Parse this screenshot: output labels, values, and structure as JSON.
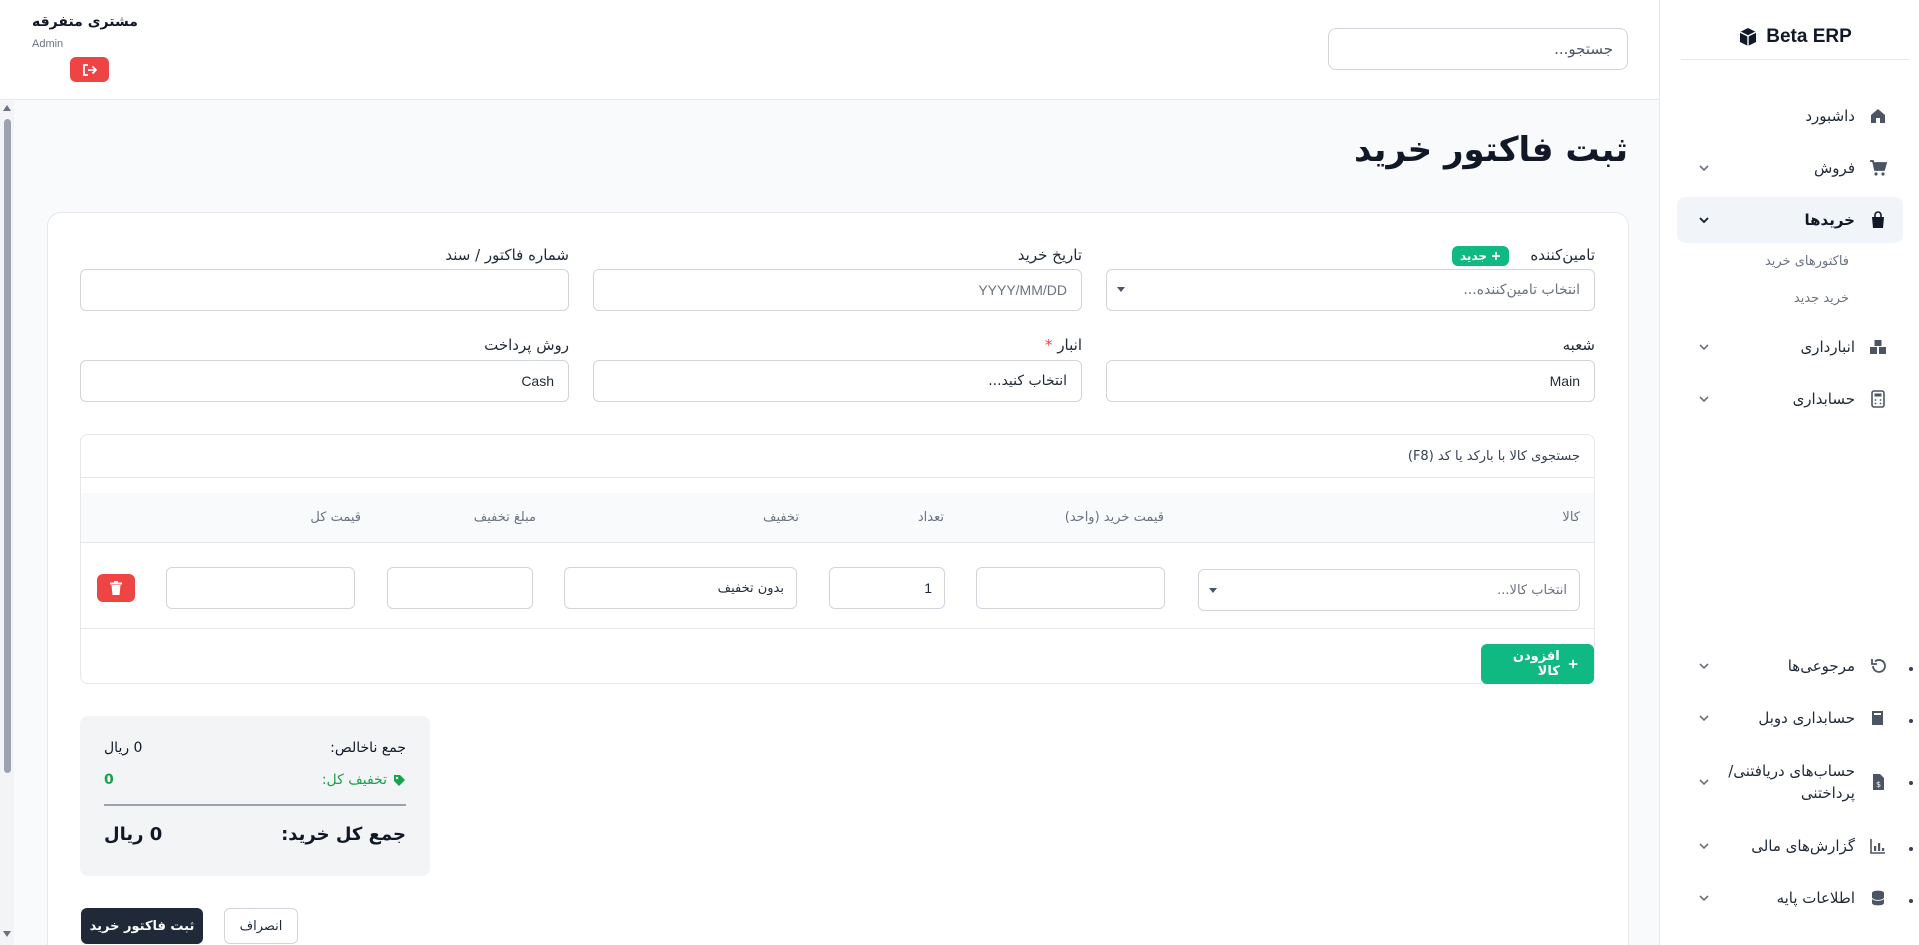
{
  "brand": {
    "name": "Beta ERP"
  },
  "sidebar": {
    "items": [
      {
        "label": "داشبورد"
      },
      {
        "label": "فروش"
      },
      {
        "label": "خریدها"
      },
      {
        "label": "انبارداری"
      },
      {
        "label": "حسابداری"
      },
      {
        "label": "مرجوعی‌ها"
      },
      {
        "label": "حسابداری دوبل"
      },
      {
        "label": "حساب‌های دریافتنی/ پرداختنی"
      },
      {
        "label": "گزارش‌های مالی"
      },
      {
        "label": "اطلاعات پایه"
      }
    ],
    "sub_items": [
      {
        "label": "فاکتورهای خرید"
      },
      {
        "label": "خرید جدید"
      }
    ]
  },
  "topbar": {
    "search_placeholder": "جستجو...",
    "user_name": "مشتری متفرقه",
    "user_role": "Admin"
  },
  "page": {
    "title": "ثبت فاکتور خرید"
  },
  "form": {
    "supplier_label": "تامین‌کننده",
    "new_badge": "جدید",
    "supplier_placeholder": "انتخاب تامین‌کننده...",
    "date_label": "تاریخ خرید",
    "date_placeholder": "YYYY/MM/DD",
    "invoice_label": "شماره فاکتور / سند",
    "invoice_value": "",
    "branch_label": "شعبه",
    "branch_value": "Main",
    "warehouse_label": "انبار",
    "warehouse_required": "*",
    "warehouse_placeholder": "انتخاب کنید...",
    "payment_label": "روش پرداخت",
    "payment_value": "Cash"
  },
  "items": {
    "search_placeholder": "جستجوی کالا با بارکد یا کد (F8)",
    "headers": [
      "کالا",
      "قیمت خرید (واحد)",
      "تعداد",
      "تخفیف",
      "مبلغ تخفیف",
      "قیمت کل"
    ],
    "rows": [
      {
        "product_placeholder": "انتخاب کالا...",
        "unit_price": "",
        "qty": "1",
        "discount": "بدون تخفیف",
        "discount_amount": "",
        "total": ""
      }
    ],
    "add_label": "افزودن کالا"
  },
  "summary": {
    "subtotal_label": "جمع ناخالص:",
    "subtotal_value": "0 ریال",
    "discount_label": "تخفیف کل:",
    "discount_value": "0",
    "total_label": "جمع کل خرید:",
    "total_value": "0 ریال"
  },
  "actions": {
    "submit_label": "ثبت فاکتور خرید",
    "cancel_label": "انصراف"
  },
  "colors": {
    "accent_green": "#10b981",
    "danger_red": "#ef4444",
    "dark": "#1f2937"
  }
}
